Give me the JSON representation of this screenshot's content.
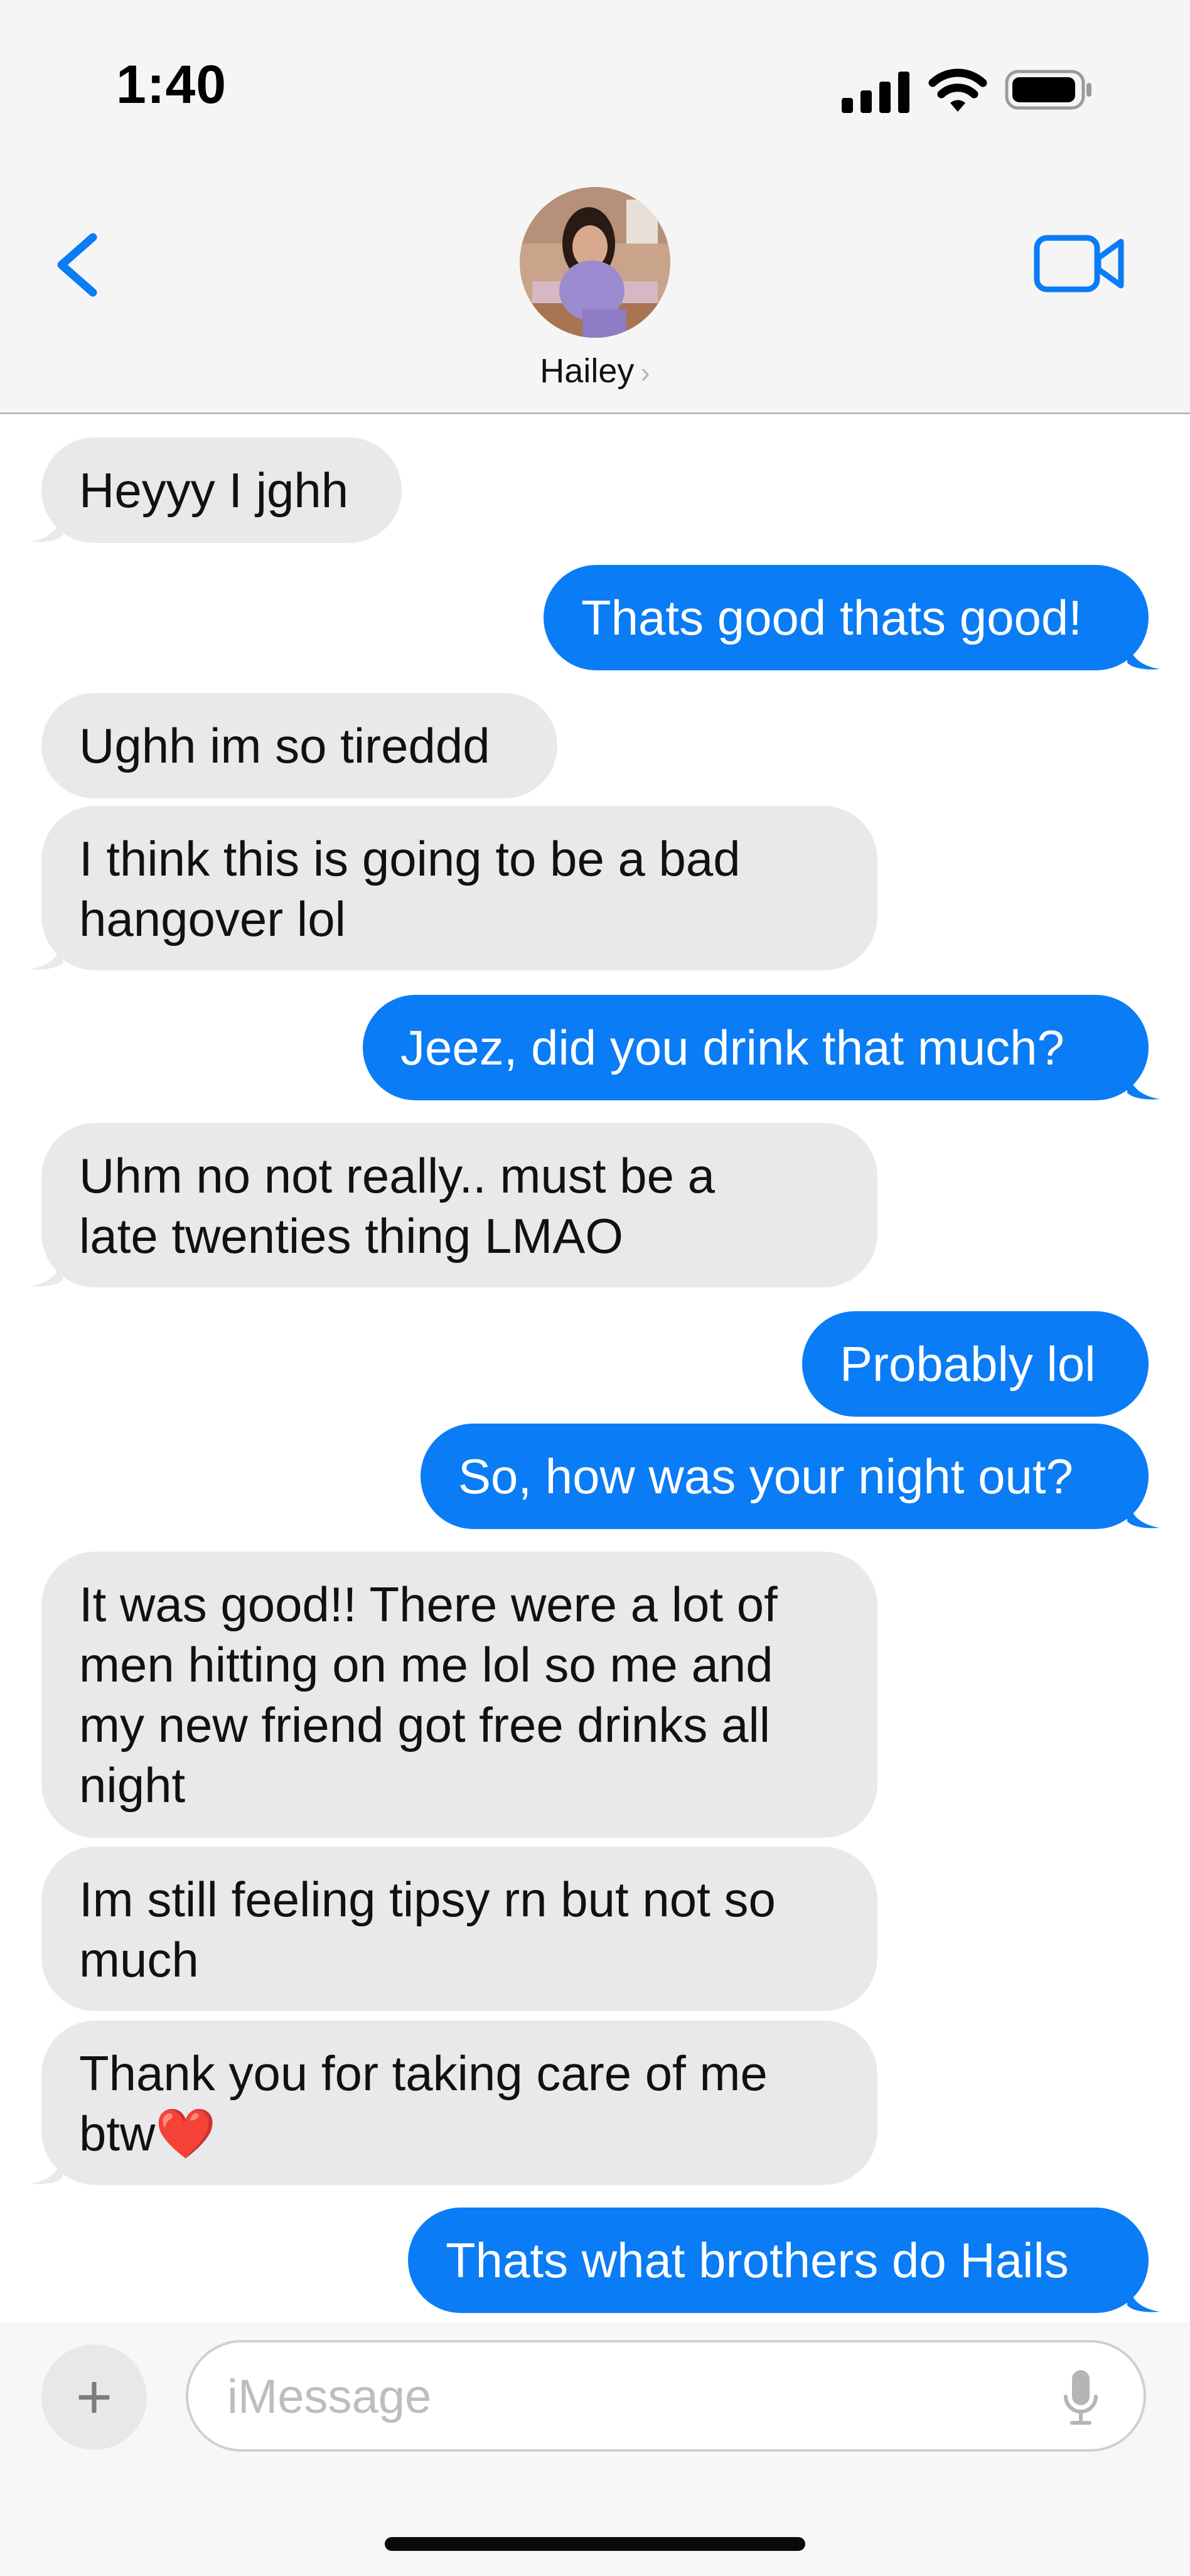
{
  "status_bar": {
    "time": "1:40",
    "signal_icon": "cellular-signal-icon",
    "wifi_icon": "wifi-icon",
    "battery_icon": "battery-icon"
  },
  "header": {
    "back_icon": "chevron-left-icon",
    "contact_name": "Hailey",
    "name_chevron": "›",
    "video_icon": "facetime-video-icon"
  },
  "colors": {
    "sent_bubble": "#0a7cf5",
    "received_bubble": "#e9e9eb",
    "accent": "#0a7cf5"
  },
  "messages": [
    {
      "direction": "received",
      "text": "Heyyy I jghh",
      "tail": true
    },
    {
      "direction": "sent",
      "text": "Thats good thats good!",
      "tail": true
    },
    {
      "direction": "received",
      "text": "Ughh im so tireddd",
      "tail": false
    },
    {
      "direction": "received",
      "text": "I think this is going to be a bad\nhangover lol",
      "tail": true
    },
    {
      "direction": "sent",
      "text": "Jeez, did you drink that much?",
      "tail": true
    },
    {
      "direction": "received",
      "text": "Uhm no not really.. must be a\nlate twenties thing LMAO",
      "tail": true
    },
    {
      "direction": "sent",
      "text": "Probably lol",
      "tail": false
    },
    {
      "direction": "sent",
      "text": "So, how was your night out?",
      "tail": true
    },
    {
      "direction": "received",
      "text": "It was good!! There were a lot of\nmen hitting on me lol so me and\nmy new friend got free drinks all\nnight",
      "tail": false
    },
    {
      "direction": "received",
      "text": "Im still feeling tipsy rn but not so\nmuch",
      "tail": false
    },
    {
      "direction": "received",
      "text": "Thank you for taking care of me\nbtw❤️",
      "tail": true
    },
    {
      "direction": "sent",
      "text": "Thats what brothers do Hails",
      "tail": true
    }
  ],
  "input_bar": {
    "plus_label": "+",
    "placeholder": "iMessage",
    "value": "",
    "mic_icon": "microphone-icon"
  }
}
